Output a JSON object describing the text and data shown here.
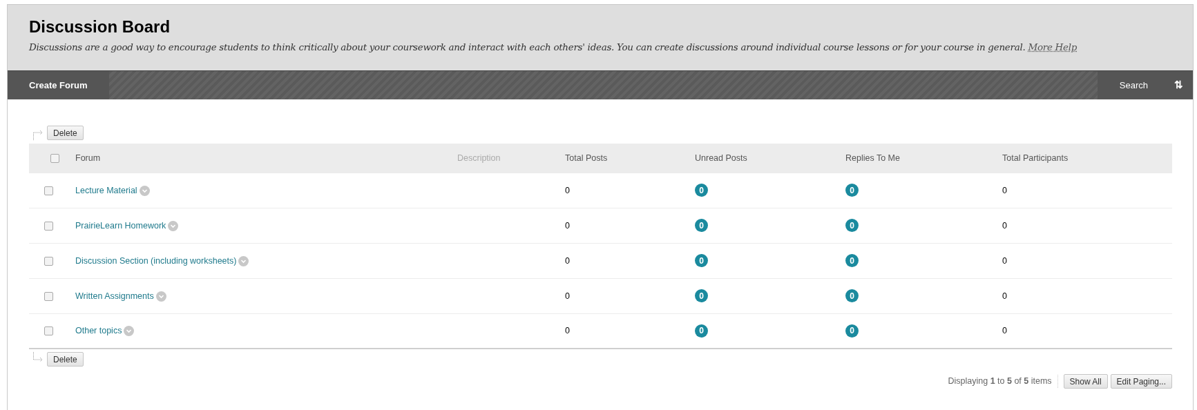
{
  "page": {
    "title": "Discussion Board",
    "description": "Discussions are a good way to encourage students to think critically about your coursework and interact with each others' ideas. You can create discussions around individual course lessons or for your course in general.",
    "help_link": "More Help"
  },
  "toolbar": {
    "create": "Create Forum",
    "search": "Search",
    "sort": "⇅"
  },
  "actions": {
    "delete_top": "Delete",
    "delete_bottom": "Delete"
  },
  "table": {
    "select_all_checked": false,
    "columns": [
      {
        "label": "Forum",
        "muted": false
      },
      {
        "label": "Description",
        "muted": true
      },
      {
        "label": "Total Posts",
        "muted": false
      },
      {
        "label": "Unread Posts",
        "muted": false
      },
      {
        "label": "Replies To Me",
        "muted": false
      },
      {
        "label": "Total Participants",
        "muted": false
      }
    ],
    "rows": [
      {
        "forum": "Lecture Material",
        "checked": false,
        "total_posts": "0",
        "unread_posts": "0",
        "replies_to_me": "0",
        "total_participants": "0"
      },
      {
        "forum": "PrairieLearn Homework",
        "checked": false,
        "total_posts": "0",
        "unread_posts": "0",
        "replies_to_me": "0",
        "total_participants": "0"
      },
      {
        "forum": "Discussion Section (including worksheets)",
        "checked": false,
        "total_posts": "0",
        "unread_posts": "0",
        "replies_to_me": "0",
        "total_participants": "0"
      },
      {
        "forum": "Written Assignments",
        "checked": false,
        "total_posts": "0",
        "unread_posts": "0",
        "replies_to_me": "0",
        "total_participants": "0"
      },
      {
        "forum": "Other topics",
        "checked": false,
        "total_posts": "0",
        "unread_posts": "0",
        "replies_to_me": "0",
        "total_participants": "0"
      }
    ]
  },
  "paging": {
    "summary": "Displaying **1** to **5** of **5** items",
    "show_all": "Show All",
    "edit_paging": "Edit Paging..."
  }
}
